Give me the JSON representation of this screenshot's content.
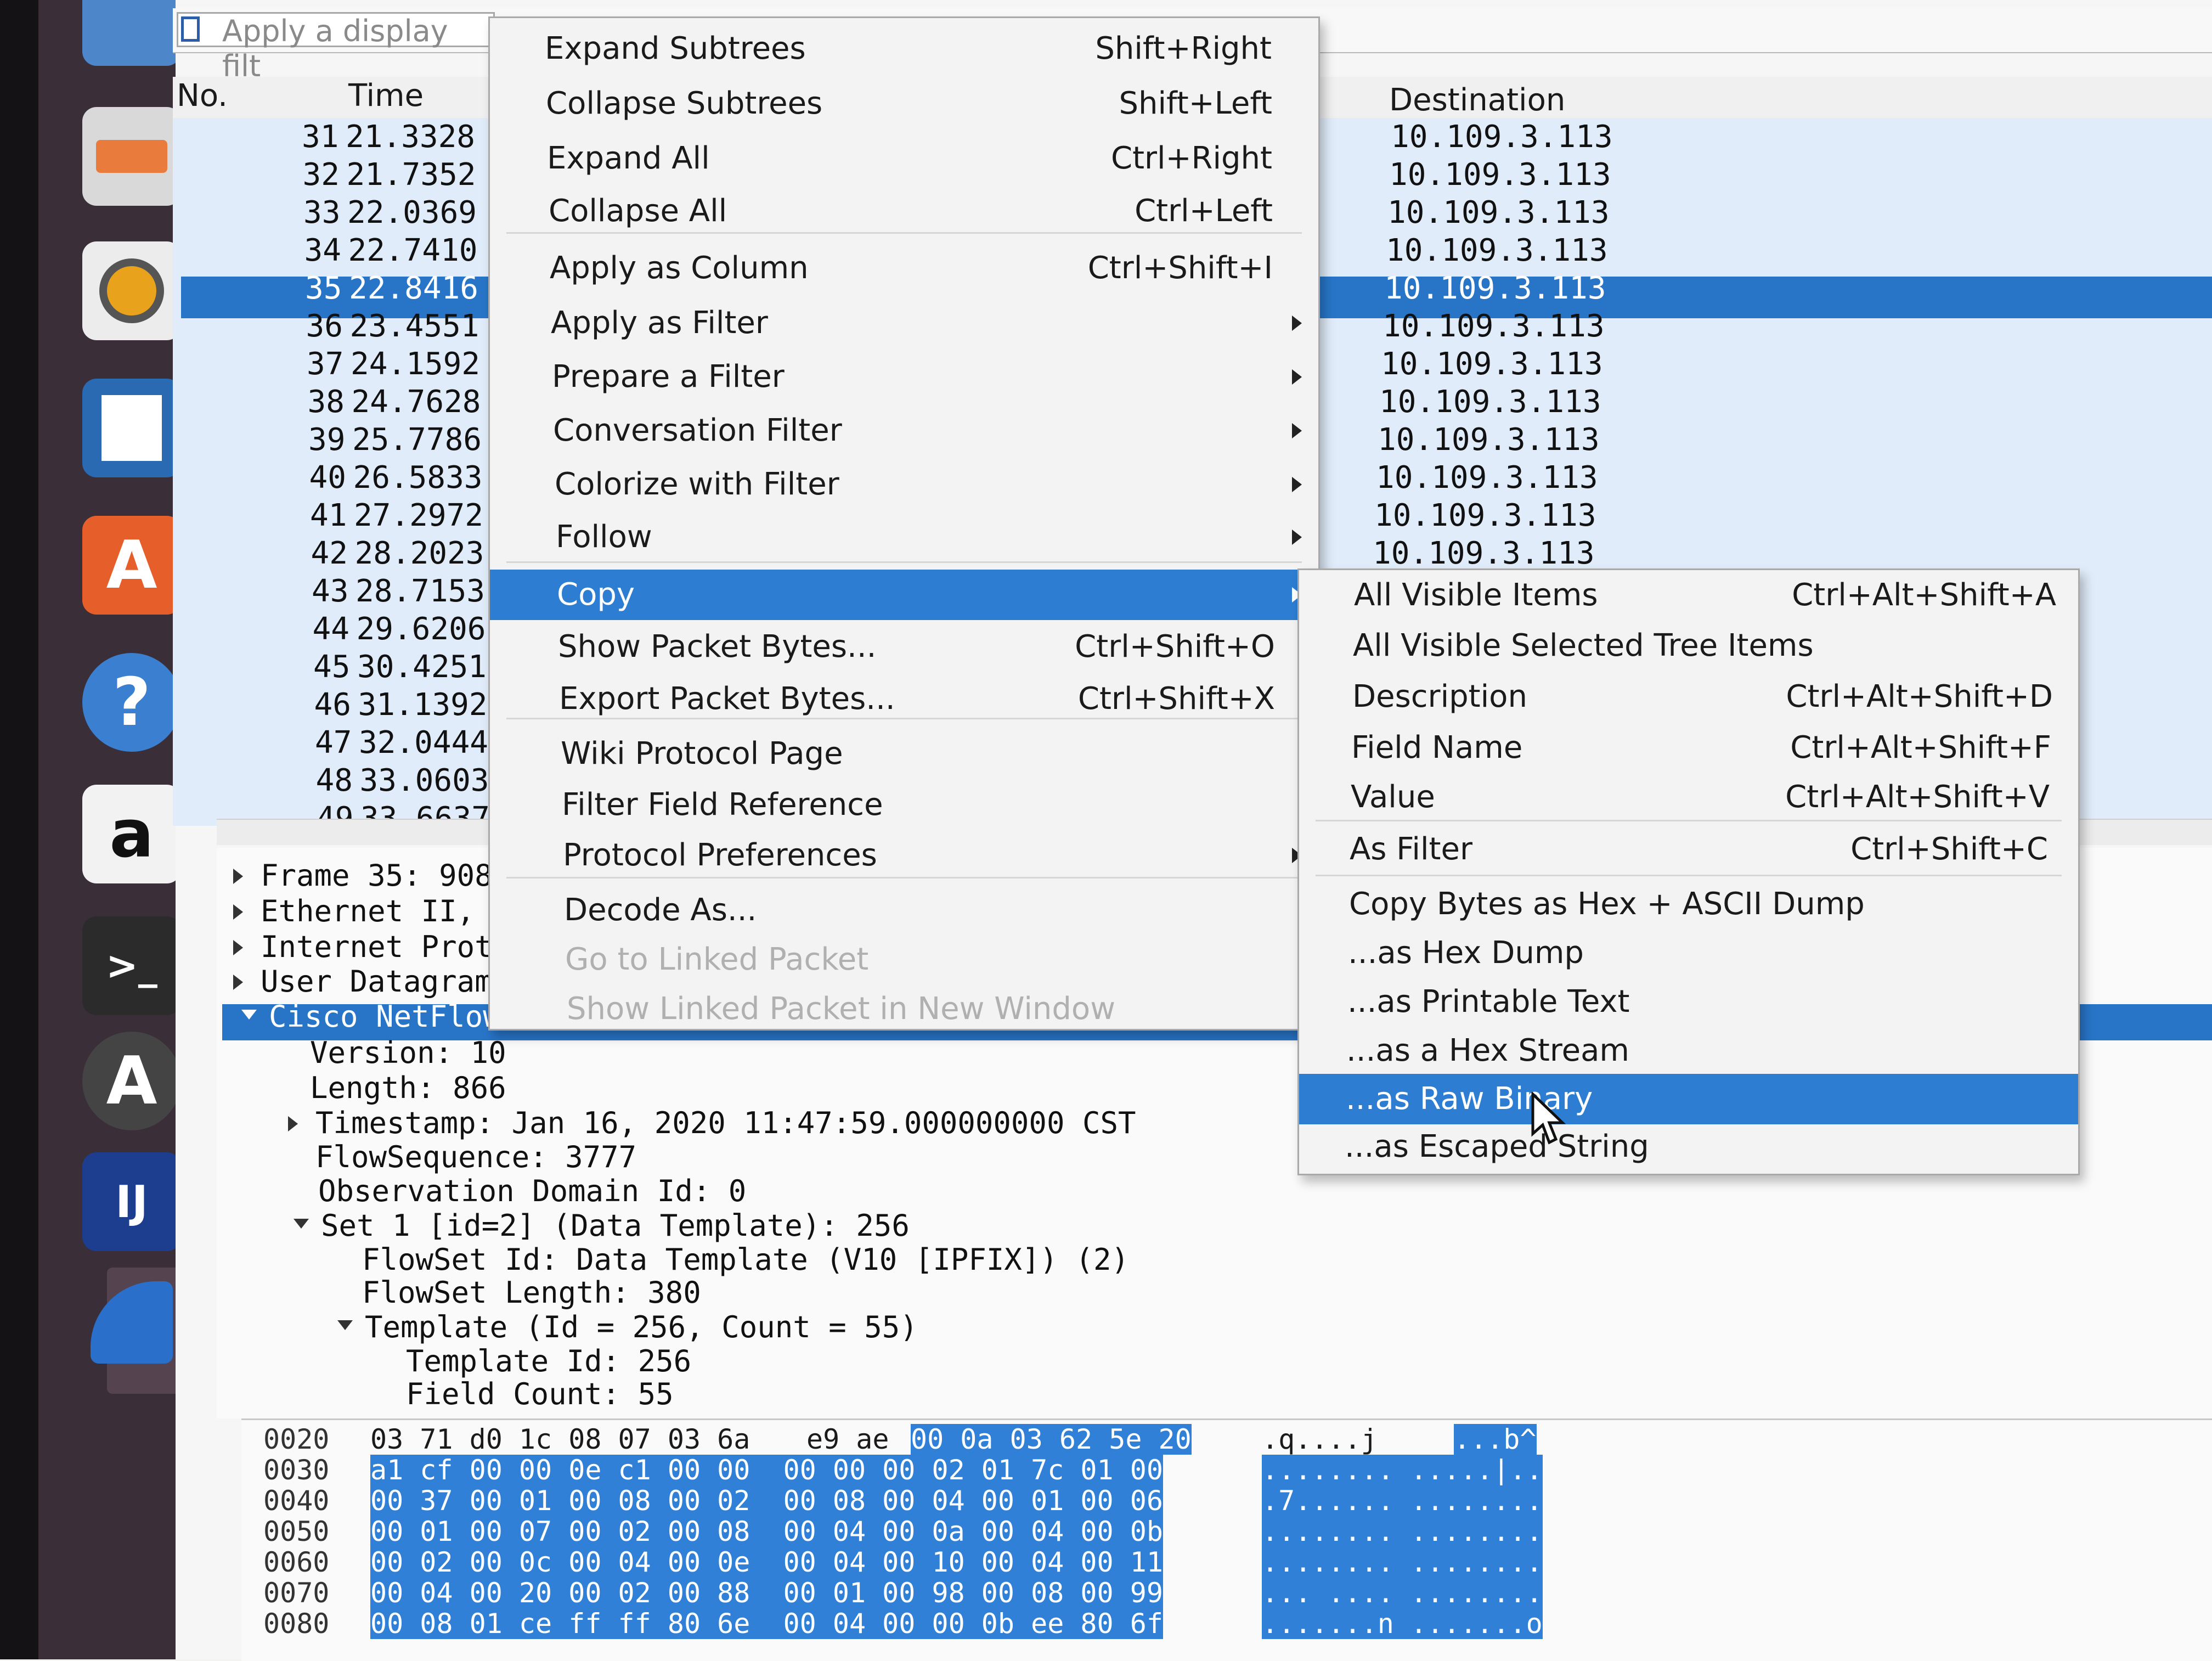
{
  "filter": {
    "placeholder": "Apply a display filt"
  },
  "columns": {
    "no": "No.",
    "time": "Time",
    "destination": "Destination"
  },
  "packets": [
    {
      "no": "31",
      "time": "21.3328",
      "dst": "10.109.3.113"
    },
    {
      "no": "32",
      "time": "21.7352",
      "dst": "10.109.3.113"
    },
    {
      "no": "33",
      "time": "22.0369",
      "dst": "10.109.3.113"
    },
    {
      "no": "34",
      "time": "22.7410",
      "dst": "10.109.3.113"
    },
    {
      "no": "35",
      "time": "22.8416",
      "dst": "10.109.3.113"
    },
    {
      "no": "36",
      "time": "23.4551",
      "dst": "10.109.3.113"
    },
    {
      "no": "37",
      "time": "24.1592",
      "dst": "10.109.3.113"
    },
    {
      "no": "38",
      "time": "24.7628",
      "dst": "10.109.3.113"
    },
    {
      "no": "39",
      "time": "25.7786",
      "dst": "10.109.3.113"
    },
    {
      "no": "40",
      "time": "26.5833",
      "dst": "10.109.3.113"
    },
    {
      "no": "41",
      "time": "27.2972",
      "dst": "10.109.3.113"
    },
    {
      "no": "42",
      "time": "28.2023",
      "dst": "10.109.3.113"
    },
    {
      "no": "43",
      "time": "28.7153",
      "dst": ""
    },
    {
      "no": "44",
      "time": "29.6206",
      "dst": ""
    },
    {
      "no": "45",
      "time": "30.4251",
      "dst": ""
    },
    {
      "no": "46",
      "time": "31.1392",
      "dst": ""
    },
    {
      "no": "47",
      "time": "32.0444",
      "dst": ""
    },
    {
      "no": "48",
      "time": "33.0603",
      "dst": ""
    },
    {
      "no": "49",
      "time": "33.6637",
      "dst": ""
    }
  ],
  "details": [
    "Frame 35: 908",
    "Ethernet II, S",
    "Internet Proto",
    "User Datagram",
    "Cisco NetFlow/",
    "Version: 10",
    "Length: 866",
    "Timestamp: Jan 16, 2020 11:47:59.000000000 CST",
    "FlowSequence: 3777",
    "Observation Domain Id: 0",
    "Set 1 [id=2] (Data Template): 256",
    "FlowSet Id: Data Template (V10 [IPFIX]) (2)",
    "FlowSet Length: 380",
    "Template (Id = 256, Count = 55)",
    "Template Id: 256",
    "Field Count: 55"
  ],
  "bytes": [
    {
      "off": "0020",
      "a": "03 71 d0 1c 08 07 03 6a",
      "b": "e9 ae",
      "c": "00 0a 03 62 5e 20",
      "ascii1": ".q....j",
      "ascii2": "...b^"
    },
    {
      "off": "0030",
      "a": "",
      "b": "",
      "c": "a1 cf 00 00 0e c1 00 00  00 00 00 02 01 7c 01 00",
      "ascii1": "",
      "ascii2": "........ .....|.."
    },
    {
      "off": "0040",
      "a": "",
      "b": "",
      "c": "00 37 00 01 00 08 00 02  00 08 00 04 00 01 00 06",
      "ascii1": "",
      "ascii2": ".7...... ........"
    },
    {
      "off": "0050",
      "a": "",
      "b": "",
      "c": "00 01 00 07 00 02 00 08  00 04 00 0a 00 04 00 0b",
      "ascii1": "",
      "ascii2": "........ ........"
    },
    {
      "off": "0060",
      "a": "",
      "b": "",
      "c": "00 02 00 0c 00 04 00 0e  00 04 00 10 00 04 00 11",
      "ascii1": "",
      "ascii2": "........ ........"
    },
    {
      "off": "0070",
      "a": "",
      "b": "",
      "c": "00 04 00 20 00 02 00 88  00 01 00 98 00 08 00 99",
      "ascii1": "",
      "ascii2": "... .... ........"
    },
    {
      "off": "0080",
      "a": "",
      "b": "",
      "c": "00 08 01 ce ff ff 80 6e  00 04 00 00 0b ee 80 6f",
      "ascii1": "",
      "ascii2": ".......n .......o"
    }
  ],
  "context_menu": {
    "items": [
      {
        "label": "Expand Subtrees",
        "shortcut": "Shift+Right"
      },
      {
        "label": "Collapse Subtrees",
        "shortcut": "Shift+Left"
      },
      {
        "label": "Expand All",
        "shortcut": "Ctrl+Right"
      },
      {
        "label": "Collapse All",
        "shortcut": "Ctrl+Left"
      },
      {
        "label": "Apply as Column",
        "shortcut": "Ctrl+Shift+I"
      },
      {
        "label": "Apply as Filter",
        "shortcut": ""
      },
      {
        "label": "Prepare a Filter",
        "shortcut": ""
      },
      {
        "label": "Conversation Filter",
        "shortcut": ""
      },
      {
        "label": "Colorize with Filter",
        "shortcut": ""
      },
      {
        "label": "Follow",
        "shortcut": ""
      },
      {
        "label": "Copy",
        "shortcut": ""
      },
      {
        "label": "Show Packet Bytes...",
        "shortcut": "Ctrl+Shift+O"
      },
      {
        "label": "Export Packet Bytes...",
        "shortcut": "Ctrl+Shift+X"
      },
      {
        "label": "Wiki Protocol Page",
        "shortcut": ""
      },
      {
        "label": "Filter Field Reference",
        "shortcut": ""
      },
      {
        "label": "Protocol Preferences",
        "shortcut": ""
      },
      {
        "label": "Decode As...",
        "shortcut": ""
      },
      {
        "label": "Go to Linked Packet",
        "shortcut": ""
      },
      {
        "label": "Show Linked Packet in New Window",
        "shortcut": ""
      }
    ]
  },
  "copy_submenu": {
    "items": [
      {
        "label": "All Visible Items",
        "shortcut": "Ctrl+Alt+Shift+A"
      },
      {
        "label": "All Visible Selected Tree Items",
        "shortcut": ""
      },
      {
        "label": "Description",
        "shortcut": "Ctrl+Alt+Shift+D"
      },
      {
        "label": "Field Name",
        "shortcut": "Ctrl+Alt+Shift+F"
      },
      {
        "label": "Value",
        "shortcut": "Ctrl+Alt+Shift+V"
      },
      {
        "label": "As Filter",
        "shortcut": "Ctrl+Shift+C"
      },
      {
        "label": "Copy Bytes as Hex + ASCII Dump",
        "shortcut": ""
      },
      {
        "label": "...as Hex Dump",
        "shortcut": ""
      },
      {
        "label": "...as Printable Text",
        "shortcut": ""
      },
      {
        "label": "...as a Hex Stream",
        "shortcut": ""
      },
      {
        "label": "...as Raw Binary",
        "shortcut": ""
      },
      {
        "label": "...as Escaped String",
        "shortcut": ""
      }
    ]
  },
  "colors": {
    "selection": "#2875c8",
    "launcher": "#3a2f38",
    "accent": "#e95420"
  },
  "launcher_icons": [
    "files-icon",
    "rhythmbox-icon",
    "libreoffice-writer-icon",
    "software-center-icon",
    "help-icon",
    "amazon-icon",
    "terminal-icon",
    "software-updater-icon",
    "intellij-icon",
    "wireshark-icon"
  ]
}
